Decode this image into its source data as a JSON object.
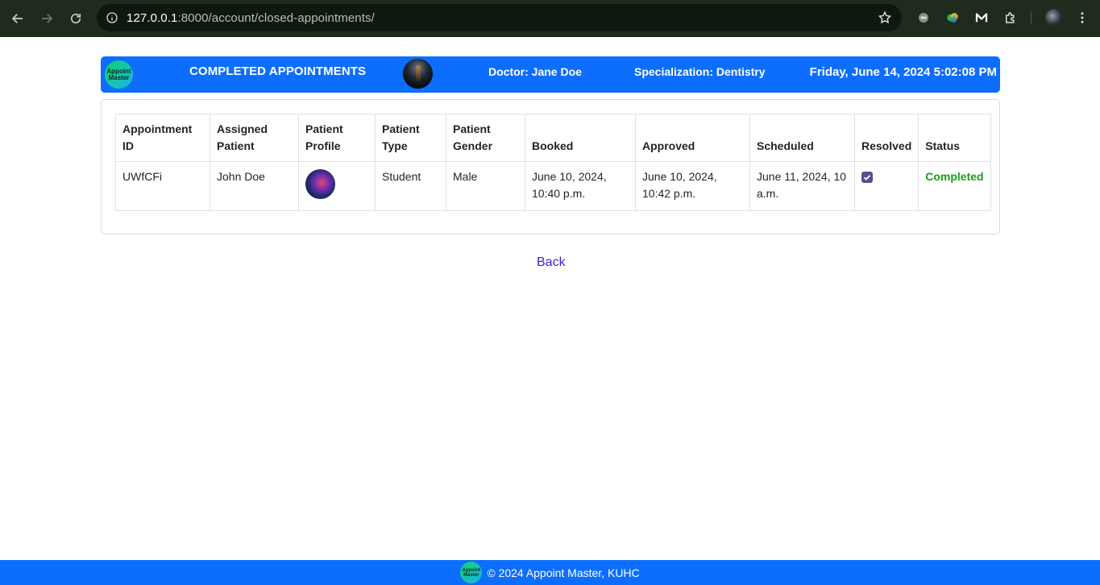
{
  "browser": {
    "url_host": "127.0.0.1",
    "url_rest": ":8000/account/closed-appointments/"
  },
  "header": {
    "logo_text_1": "Appoint",
    "logo_text_2": "Master",
    "title": "COMPLETED APPOINTMENTS",
    "doctor": "Doctor: Jane Doe",
    "specialization": "Specialization: Dentistry",
    "datetime": "Friday, June 14, 2024 5:02:08 PM"
  },
  "table": {
    "headers": [
      "Appointment ID",
      "Assigned Patient",
      "Patient Profile",
      "Patient Type",
      "Patient Gender",
      "Booked",
      "Approved",
      "Scheduled",
      "Resolved",
      "Status"
    ],
    "rows": [
      {
        "id": "UWfCFi",
        "patient": "John Doe",
        "type": "Student",
        "gender": "Male",
        "booked": "June 10, 2024, 10:40 p.m.",
        "approved": "June 10, 2024, 10:42 p.m.",
        "scheduled": "June 11, 2024, 10 a.m.",
        "resolved": true,
        "status": "Completed"
      }
    ]
  },
  "back_label": "Back",
  "footer": {
    "text": "© 2024 Appoint Master, KUHC"
  },
  "colors": {
    "brand": "#0d6efd",
    "status_completed": "#1a9e1a",
    "checkbox": "#55508f",
    "link": "#3c1fd0"
  }
}
